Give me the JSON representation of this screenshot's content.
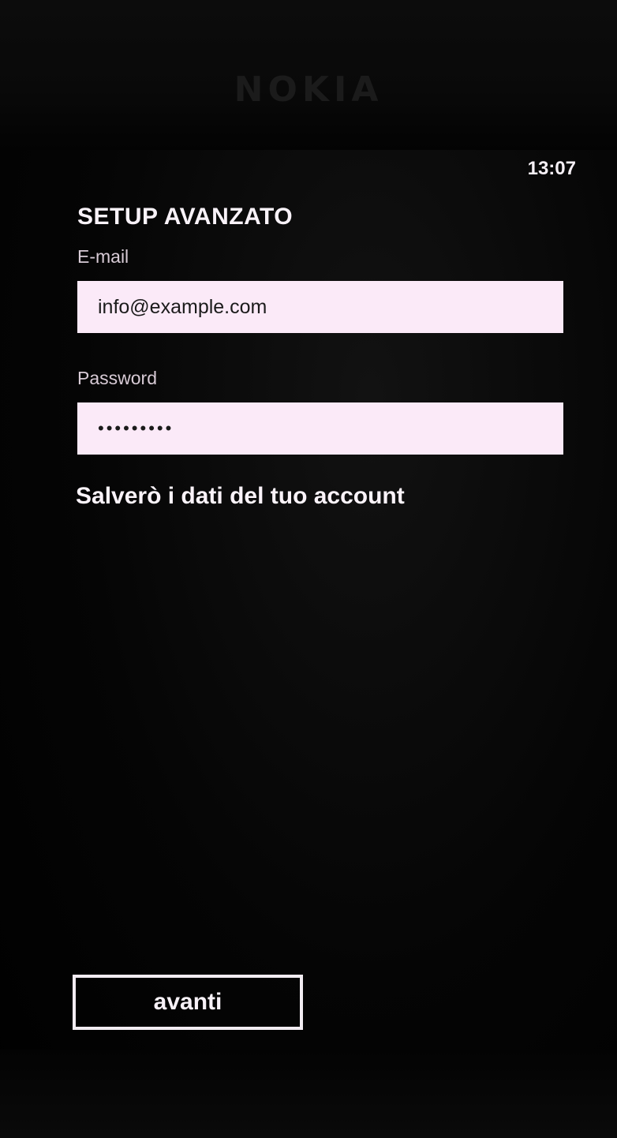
{
  "device": {
    "brand": "NOKIA"
  },
  "status_bar": {
    "time": "13:07"
  },
  "page": {
    "title": "SETUP AVANZATO"
  },
  "form": {
    "email": {
      "label": "E-mail",
      "value": "info@example.com"
    },
    "password": {
      "label": "Password",
      "value": "•••••••••"
    },
    "info_text": "Salverò i dati del tuo account"
  },
  "actions": {
    "next_label": "avanti"
  },
  "colors": {
    "background": "#000000",
    "textbox_fill": "#fbeaf8",
    "foreground": "#ffffff"
  }
}
